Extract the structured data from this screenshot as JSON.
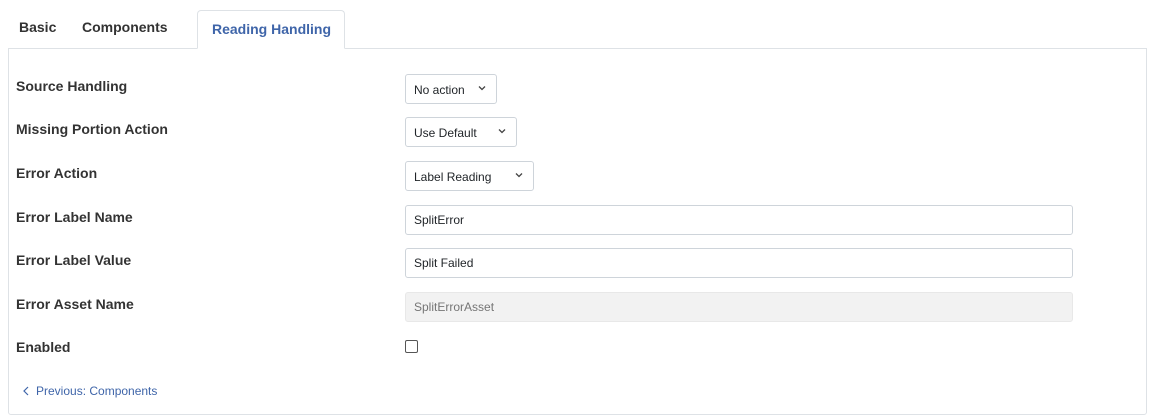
{
  "tabs": {
    "basic": "Basic",
    "components": "Components",
    "reading_handling": "Reading Handling"
  },
  "form": {
    "source_handling": {
      "label": "Source Handling",
      "value": "No action"
    },
    "missing_portion_action": {
      "label": "Missing Portion Action",
      "value": "Use Default"
    },
    "error_action": {
      "label": "Error Action",
      "value": "Label Reading"
    },
    "error_label_name": {
      "label": "Error Label Name",
      "value": "SplitError"
    },
    "error_label_value": {
      "label": "Error Label Value",
      "value": "Split Failed"
    },
    "error_asset_name": {
      "label": "Error Asset Name",
      "placeholder": "SplitErrorAsset"
    },
    "enabled": {
      "label": "Enabled",
      "checked": false
    }
  },
  "nav": {
    "previous_label": "Previous: Components"
  },
  "colors": {
    "accent": "#3f65a9",
    "border": "#dee2e6",
    "disabled_bg": "#f2f2f2"
  }
}
